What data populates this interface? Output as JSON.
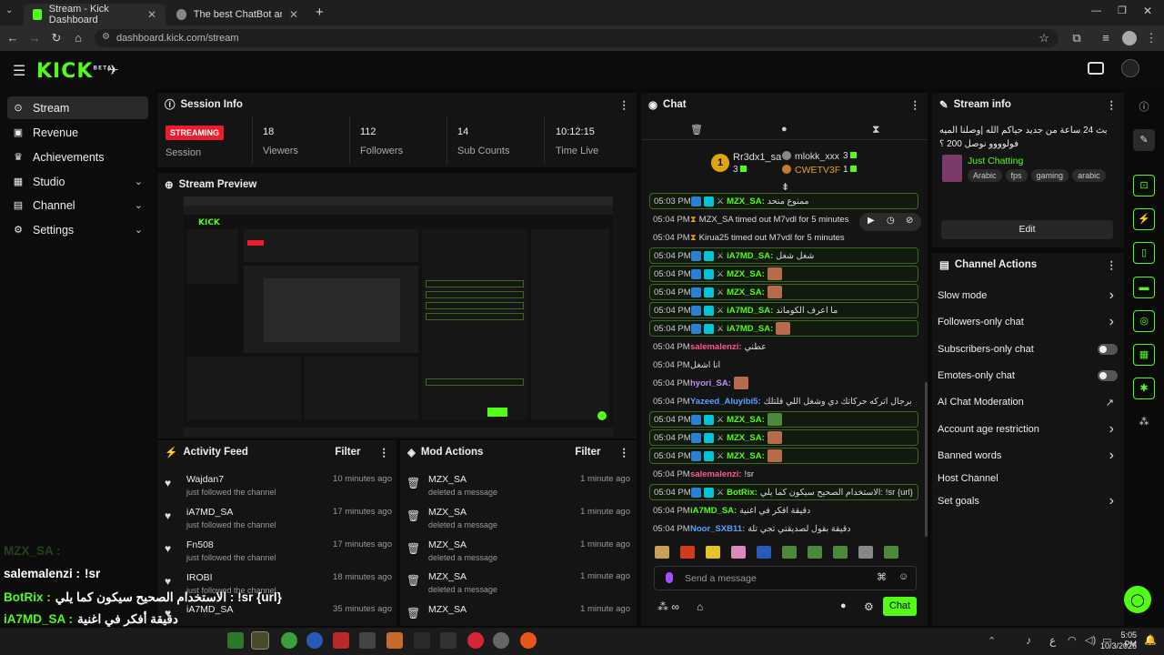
{
  "browser": {
    "tabs": [
      {
        "label": "Stream - Kick Dashboard"
      },
      {
        "label": "The best ChatBot and Widgets f"
      }
    ],
    "url": "dashboard.kick.com/stream"
  },
  "app": {
    "logo": "KICK",
    "logo_sup": "BETA"
  },
  "nav": {
    "items": [
      {
        "label": "Stream"
      },
      {
        "label": "Revenue"
      },
      {
        "label": "Achievements"
      },
      {
        "label": "Studio"
      },
      {
        "label": "Channel"
      },
      {
        "label": "Settings"
      }
    ]
  },
  "session": {
    "title": "Session Info",
    "status": "STREAMING",
    "status_label": "Session",
    "stats": [
      {
        "value": "18",
        "label": "Viewers"
      },
      {
        "value": "112",
        "label": "Followers"
      },
      {
        "value": "14",
        "label": "Sub Counts"
      },
      {
        "value": "10:12:15",
        "label": "Time Live"
      }
    ]
  },
  "preview": {
    "title": "Stream Preview"
  },
  "activity": {
    "title": "Activity Feed",
    "filter": "Filter",
    "items": [
      {
        "who": "Wajdan7",
        "what": "just followed the channel",
        "time": "10 minutes ago"
      },
      {
        "who": "iA7MD_SA",
        "what": "just followed the channel",
        "time": "17 minutes ago"
      },
      {
        "who": "Fn508",
        "what": "just followed the channel",
        "time": "17 minutes ago"
      },
      {
        "who": "IROBI",
        "what": "just followed the channel",
        "time": "18 minutes ago"
      },
      {
        "who": "iA7MD_SA",
        "what": "",
        "time": "35 minutes ago"
      }
    ]
  },
  "mod": {
    "title": "Mod Actions",
    "filter": "Filter",
    "items": [
      {
        "who": "MZX_SA",
        "what": "deleted a message",
        "time": "1 minute ago"
      },
      {
        "who": "MZX_SA",
        "what": "deleted a message",
        "time": "1 minute ago"
      },
      {
        "who": "MZX_SA",
        "what": "deleted a message",
        "time": "1 minute ago"
      },
      {
        "who": "MZX_SA",
        "what": "deleted a message",
        "time": "1 minute ago"
      },
      {
        "who": "MZX_SA",
        "what": "",
        "time": "1 minute ago"
      }
    ]
  },
  "chat": {
    "title": "Chat",
    "leaders": [
      {
        "name": "Rr3dx1_sa",
        "rank": "1",
        "count": "3"
      },
      {
        "name": "mlokk_xxx",
        "count": "3"
      },
      {
        "name": "CWETV3F",
        "count": "1"
      }
    ],
    "messages": [
      {
        "time": "05:03 PM",
        "user": "MZX_SA:",
        "color": "#53fc18",
        "text": "ممنوع منحد",
        "hl": true
      },
      {
        "time": "05:04 PM",
        "sys": "MZX_SA timed out M7vdl for 5 minutes"
      },
      {
        "time": "05:04 PM",
        "sys": "Kirua25 timed out M7vdl for 5 minutes"
      },
      {
        "time": "05:04 PM",
        "user": "iA7MD_SA:",
        "color": "#53fc18",
        "text": "شغل شغل",
        "hl": true
      },
      {
        "time": "05:04 PM",
        "user": "MZX_SA:",
        "color": "#53fc18",
        "text": "",
        "hl": true
      },
      {
        "time": "05:04 PM",
        "user": "MZX_SA:",
        "color": "#53fc18",
        "text": "",
        "hl": true
      },
      {
        "time": "05:04 PM",
        "user": "iA7MD_SA:",
        "color": "#53fc18",
        "text": "ما اعرف الكوماند",
        "hl": true
      },
      {
        "time": "05:04 PM",
        "user": "iA7MD_SA:",
        "color": "#53fc18",
        "text": "",
        "hl": true
      },
      {
        "time": "05:04 PM",
        "user": "salemalenzi:",
        "color": "#ff5a8a",
        "text": "عطني"
      },
      {
        "time": "05:04 PM",
        "user": "",
        "color": "#ff5a8a",
        "text": "انا اشغل"
      },
      {
        "time": "05:04 PM",
        "user": "hyori_SA:",
        "color": "#c58af9",
        "text": ""
      },
      {
        "time": "05:04 PM",
        "user": "Yazeed_Aluyibi5:",
        "color": "#5aa0ff",
        "text": "برجال اتركه حركاتك دي وشغل اللي قلتلك"
      },
      {
        "time": "05:04 PM",
        "user": "MZX_SA:",
        "color": "#53fc18",
        "text": "",
        "hl": true
      },
      {
        "time": "05:04 PM",
        "user": "MZX_SA:",
        "color": "#53fc18",
        "text": "",
        "hl": true
      },
      {
        "time": "05:04 PM",
        "user": "MZX_SA:",
        "color": "#53fc18",
        "text": "",
        "hl": true
      },
      {
        "time": "05:04 PM",
        "user": "salemalenzi:",
        "color": "#ff5a8a",
        "text": "!sr"
      },
      {
        "time": "05:04 PM",
        "user": "BotRix:",
        "color": "#53fc18",
        "text": "الاستخدام الصحيح سيكون كما يلي: !sr {url}",
        "hl": true
      },
      {
        "time": "05:04 PM",
        "user": "iA7MD_SA:",
        "color": "#53fc18",
        "text": "دقيقة افكر في اغنية"
      },
      {
        "time": "05:04 PM",
        "user": "Noor_SXB11:",
        "color": "#5aa0ff",
        "text": "دقيقة بقول لصديقتي تجي تلة"
      }
    ],
    "input_placeholder": "Send a message",
    "send": "Chat"
  },
  "streaminfo": {
    "title": "Stream info",
    "stream_title": "بث 24 ساعة من جديد حياكم الله |وصلنا الميه فولوووو نوصل 200 ؟",
    "category": "Just Chatting",
    "tags": [
      "Arabic",
      "fps",
      "gaming",
      "arabic"
    ],
    "edit": "Edit"
  },
  "channel_actions": {
    "title": "Channel Actions",
    "items": [
      {
        "label": "Slow mode",
        "kind": "chev"
      },
      {
        "label": "Followers-only chat",
        "kind": "chev"
      },
      {
        "label": "Subscribers-only chat",
        "kind": "toggle"
      },
      {
        "label": "Emotes-only chat",
        "kind": "toggle"
      },
      {
        "label": "AI Chat Moderation",
        "kind": "ext"
      },
      {
        "label": "Account age restriction",
        "kind": "chev"
      },
      {
        "label": "Banned words",
        "kind": "chev"
      },
      {
        "label": "Host Channel",
        "kind": "none"
      },
      {
        "label": "Set goals",
        "kind": "chev"
      }
    ]
  },
  "overlay": {
    "lines": [
      {
        "user": "MZX_SA :",
        "text": ""
      },
      {
        "user": "salemalenzi :",
        "text": "!sr"
      },
      {
        "user": "BotRix :",
        "text": "الاستخدام الصحيح سيكون كما يلي : !sr {url}"
      },
      {
        "user": "iA7MD_SA :",
        "text": "دقيقة أفكر في اغنية"
      },
      {
        "user": "Noor_SXB11 :",
        "text": "دقيقة بقول لصديقتي تجي تلة"
      }
    ]
  },
  "taskbar": {
    "time": "5:05 PM",
    "date": "10/3/2025",
    "lang": "ع"
  },
  "colors": {
    "brand": "#53fc18",
    "streaming": "#ea1d2c"
  }
}
